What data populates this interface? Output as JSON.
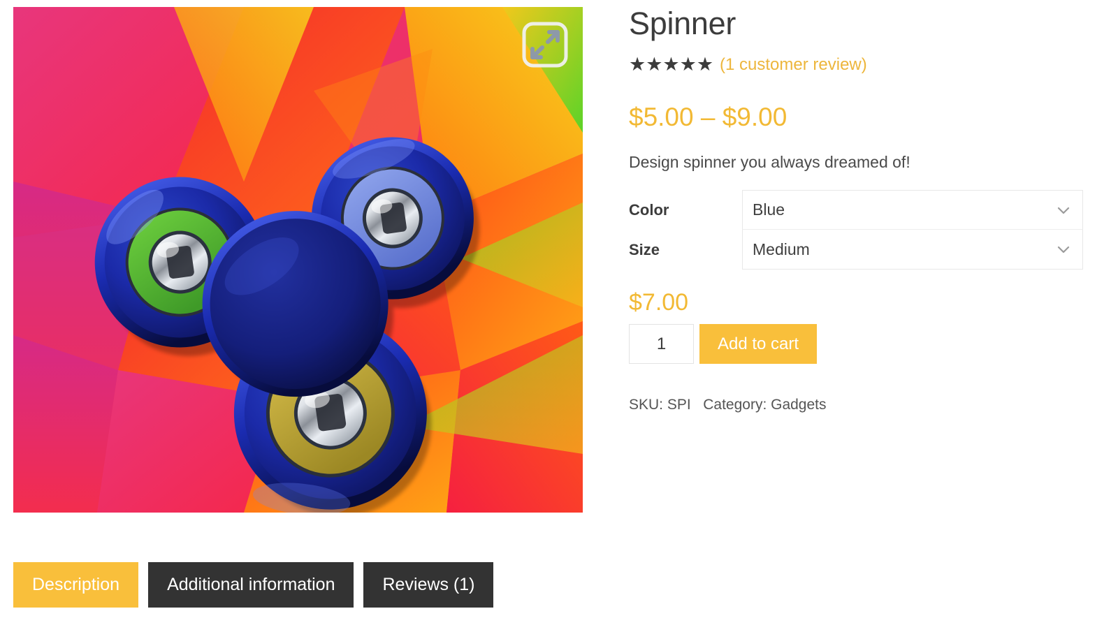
{
  "product": {
    "title": "Spinner",
    "rating_stars": "★★★★★",
    "rating_value": 5,
    "review_link": "(1 customer review)",
    "price_range": "$5.00 – $9.00",
    "short_description": "Design spinner you always dreamed of!",
    "selected_price": "$7.00",
    "quantity": "1",
    "add_to_cart_label": "Add to cart",
    "meta_sku": "SKU: SPI",
    "meta_category": "Category: Gadgets"
  },
  "variations": [
    {
      "label": "Color",
      "value": "Blue",
      "icon": "chevron-down-icon"
    },
    {
      "label": "Size",
      "value": "Medium",
      "icon": "chevron-down-icon"
    }
  ],
  "gallery": {
    "zoom_icon": "expand-icon",
    "image_alt": "Blue tri-lobe fidget spinner on low-poly rainbow background"
  },
  "tabs": [
    {
      "label": "Description",
      "active": true
    },
    {
      "label": "Additional information",
      "active": false
    },
    {
      "label": "Reviews (1)",
      "active": false
    }
  ],
  "colors": {
    "accent": "#f9bf3b",
    "price": "#f2b934",
    "link": "#edb63c",
    "tab_inactive": "#333333",
    "text": "#3c3c3c"
  }
}
